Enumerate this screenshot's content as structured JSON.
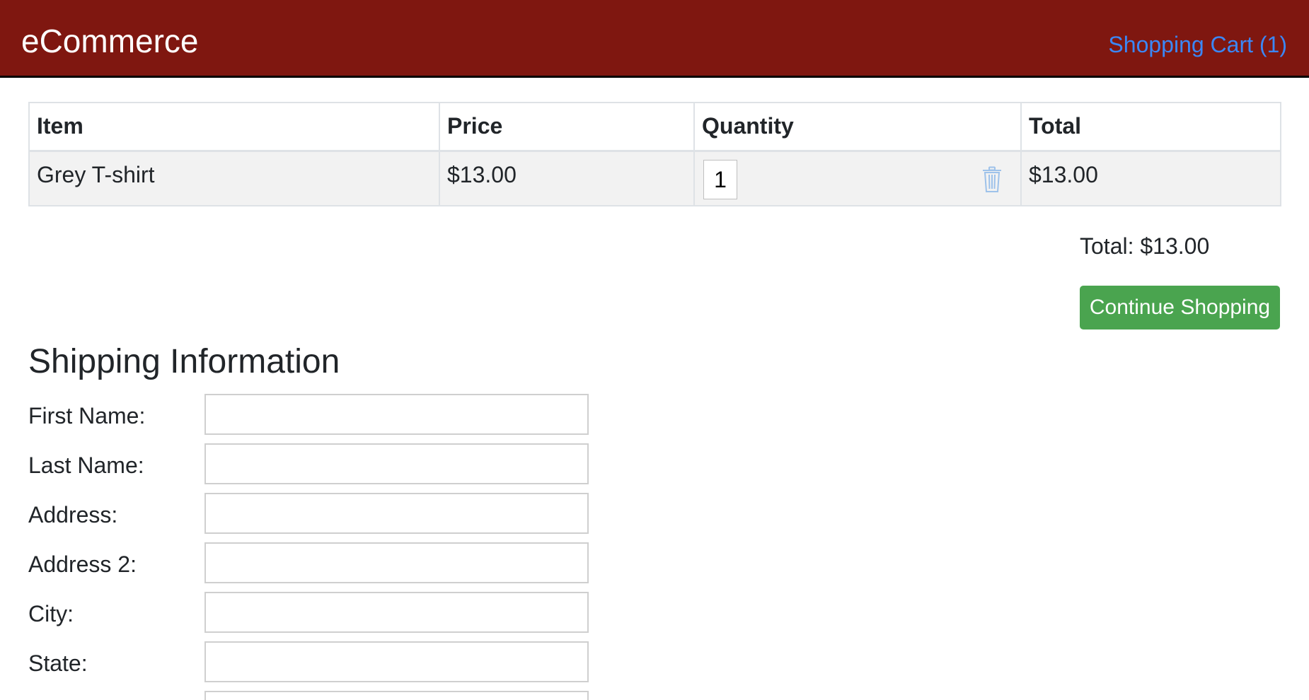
{
  "header": {
    "brand": "eCommerce",
    "cart_link": "Shopping Cart (1)"
  },
  "cart": {
    "columns": [
      "Item",
      "Price",
      "Quantity",
      "Total"
    ],
    "rows": [
      {
        "item": "Grey T-shirt",
        "price": "$13.00",
        "quantity": "1",
        "total": "$13.00"
      }
    ],
    "grand_total": "Total: $13.00",
    "continue_label": "Continue Shopping"
  },
  "shipping": {
    "title": "Shipping Information",
    "fields": [
      {
        "label": "First Name:",
        "value": ""
      },
      {
        "label": "Last Name:",
        "value": ""
      },
      {
        "label": "Address:",
        "value": ""
      },
      {
        "label": "Address 2:",
        "value": ""
      },
      {
        "label": "City:",
        "value": ""
      },
      {
        "label": "State:",
        "value": ""
      }
    ]
  },
  "colors": {
    "header_bg": "#7f1710",
    "link": "#3b87f5",
    "button_bg": "#4aa44f"
  },
  "icons": {
    "delete": "trash-icon"
  }
}
